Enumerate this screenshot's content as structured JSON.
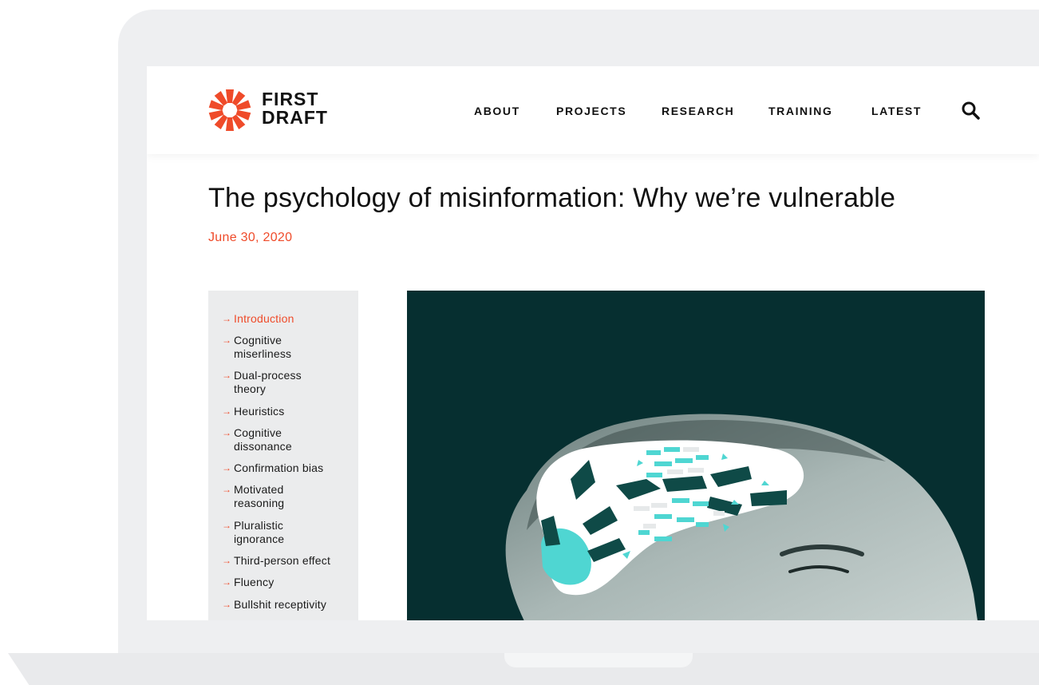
{
  "brand": {
    "line1": "FIRST",
    "line2": "DRAFT",
    "logo_color": "#ef4b2a"
  },
  "nav": {
    "items": [
      {
        "label": "ABOUT"
      },
      {
        "label": "PROJECTS"
      },
      {
        "label": "RESEARCH"
      },
      {
        "label": "TRAINING"
      },
      {
        "label": "LATEST"
      }
    ],
    "search_icon": "search-icon"
  },
  "article": {
    "title": "The psychology of misinformation: Why we’re vulnerable",
    "date": "June 30, 2020"
  },
  "toc": {
    "items": [
      {
        "line1": "Introduction",
        "line2": "",
        "active": true
      },
      {
        "line1": "Cognitive",
        "line2": "miserliness",
        "active": false
      },
      {
        "line1": "Dual-process",
        "line2": "theory",
        "active": false
      },
      {
        "line1": "Heuristics",
        "line2": "",
        "active": false
      },
      {
        "line1": "Cognitive",
        "line2": "dissonance",
        "active": false
      },
      {
        "line1": "Confirmation bias",
        "line2": "",
        "active": false
      },
      {
        "line1": "Motivated",
        "line2": "reasoning",
        "active": false
      },
      {
        "line1": "Pluralistic",
        "line2": "ignorance",
        "active": false
      },
      {
        "line1": "Third-person effect",
        "line2": "",
        "active": false
      },
      {
        "line1": "Fluency",
        "line2": "",
        "active": false
      },
      {
        "line1": "Bullshit receptivity",
        "line2": "",
        "active": false
      }
    ],
    "arrow_icon": "arrow-right-icon"
  },
  "colors": {
    "accent": "#ef4b2a",
    "hero_bg": "#062f30",
    "teal": "#4fd6d2",
    "dark_teal": "#0f4a47"
  }
}
